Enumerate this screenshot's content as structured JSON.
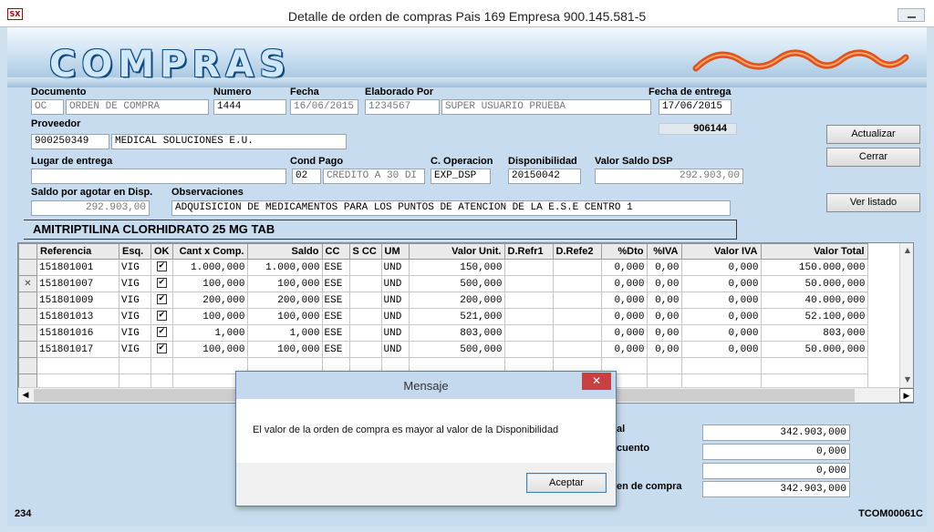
{
  "window": {
    "title": "Detalle de orden de compras Pais 169  Empresa  900.145.581-5",
    "icon": "app-logo-icon"
  },
  "banner": {
    "brand": "COMPRAS"
  },
  "form": {
    "documento_label": "Documento",
    "doc_code": "OC",
    "doc_name": "ORDEN DE COMPRA",
    "numero_label": "Numero",
    "numero": "1444",
    "fecha_label": "Fecha",
    "fecha": "16/06/2015",
    "elaborado_label": "Elaborado Por",
    "elaborado_code": "1234567",
    "elaborado_name": "SUPER USUARIO PRUEBA",
    "fecha_entrega_label": "Fecha de entrega",
    "fecha_entrega": "17/06/2015",
    "ref_number": "906144",
    "proveedor_label": "Proveedor",
    "proveedor_nit": "900250349",
    "proveedor_name": "MEDICAL SOLUCIONES E.U.",
    "lugar_label": "Lugar de entrega",
    "lugar": "",
    "cond_pago_label": "Cond Pago",
    "cond_pago_code": "02",
    "cond_pago_desc": "CREDITO A 30 DI",
    "c_operacion_label": "C. Operacion",
    "c_operacion": "EXP_DSP",
    "disponibilidad_label": "Disponibilidad",
    "disponibilidad": "20150042",
    "valor_saldo_label": "Valor Saldo DSP",
    "valor_saldo": "292.903,00",
    "saldo_agotar_label": "Saldo por agotar en Disp.",
    "saldo_agotar": "292.903,00",
    "observaciones_label": "Observaciones",
    "observaciones": "ADQUISICION DE MEDICAMENTOS PARA LOS PUNTOS DE ATENCION DE LA E.S.E CENTRO 1"
  },
  "buttons": {
    "actualizar": "Actualizar",
    "cerrar": "Cerrar",
    "ver_listado": "Ver listado"
  },
  "product": "AMITRIPTILINA CLORHIDRATO 25 MG TAB",
  "grid": {
    "columns": [
      "Referencia",
      "Esq.",
      "OK",
      "Cant x Comp.",
      "Saldo",
      "CC",
      "S CC",
      "UM",
      "Valor Unit.",
      "D.Refr1",
      "D.Refe2",
      "%Dto",
      "%IVA",
      "Valor IVA",
      "Valor Total"
    ],
    "rows": [
      {
        "ref": "151801001",
        "esq": "VIG",
        "ok": true,
        "cant": "1.000,000",
        "saldo": "1.000,000",
        "cc": "ESE",
        "scc": "",
        "um": "UND",
        "vunit": "150,000",
        "d1": "",
        "d2": "",
        "dto": "0,000",
        "iva": "0,00",
        "viva": "0,000",
        "vtotal": "150.000,000",
        "marker": ""
      },
      {
        "ref": "151801007",
        "esq": "VIG",
        "ok": true,
        "cant": "100,000",
        "saldo": "100,000",
        "cc": "ESE",
        "scc": "",
        "um": "UND",
        "vunit": "500,000",
        "d1": "",
        "d2": "",
        "dto": "0,000",
        "iva": "0,00",
        "viva": "0,000",
        "vtotal": "50.000,000",
        "marker": "✕"
      },
      {
        "ref": "151801009",
        "esq": "VIG",
        "ok": true,
        "cant": "200,000",
        "saldo": "200,000",
        "cc": "ESE",
        "scc": "",
        "um": "UND",
        "vunit": "200,000",
        "d1": "",
        "d2": "",
        "dto": "0,000",
        "iva": "0,00",
        "viva": "0,000",
        "vtotal": "40.000,000",
        "marker": ""
      },
      {
        "ref": "151801013",
        "esq": "VIG",
        "ok": true,
        "cant": "100,000",
        "saldo": "100,000",
        "cc": "ESE",
        "scc": "",
        "um": "UND",
        "vunit": "521,000",
        "d1": "",
        "d2": "",
        "dto": "0,000",
        "iva": "0,00",
        "viva": "0,000",
        "vtotal": "52.100,000",
        "marker": ""
      },
      {
        "ref": "151801016",
        "esq": "VIG",
        "ok": true,
        "cant": "1,000",
        "saldo": "1,000",
        "cc": "ESE",
        "scc": "",
        "um": "UND",
        "vunit": "803,000",
        "d1": "",
        "d2": "",
        "dto": "0,000",
        "iva": "0,00",
        "viva": "0,000",
        "vtotal": "803,000",
        "marker": ""
      },
      {
        "ref": "151801017",
        "esq": "VIG",
        "ok": true,
        "cant": "100,000",
        "saldo": "100,000",
        "cc": "ESE",
        "scc": "",
        "um": "UND",
        "vunit": "500,000",
        "d1": "",
        "d2": "",
        "dto": "0,000",
        "iva": "0,00",
        "viva": "0,000",
        "vtotal": "50.000,000",
        "marker": ""
      }
    ],
    "empty_rows": 2
  },
  "totals": {
    "label1": "al",
    "value1": "342.903,000",
    "label2": "cuento",
    "value2": "0,000",
    "value3": "0,000",
    "label4": "en de compra",
    "value4": "342.903,000"
  },
  "status": {
    "left": "234",
    "right": "TCOM00061C"
  },
  "dialog": {
    "title": "Mensaje",
    "message": "El valor de la orden de compra es mayor al valor de la Disponibilidad",
    "ok_label": "Aceptar"
  },
  "colors": {
    "background": "#c7dcee",
    "brand_outline": "#0d4a80",
    "logo_wave": "#e0541b",
    "dialog_close": "#c74141"
  }
}
